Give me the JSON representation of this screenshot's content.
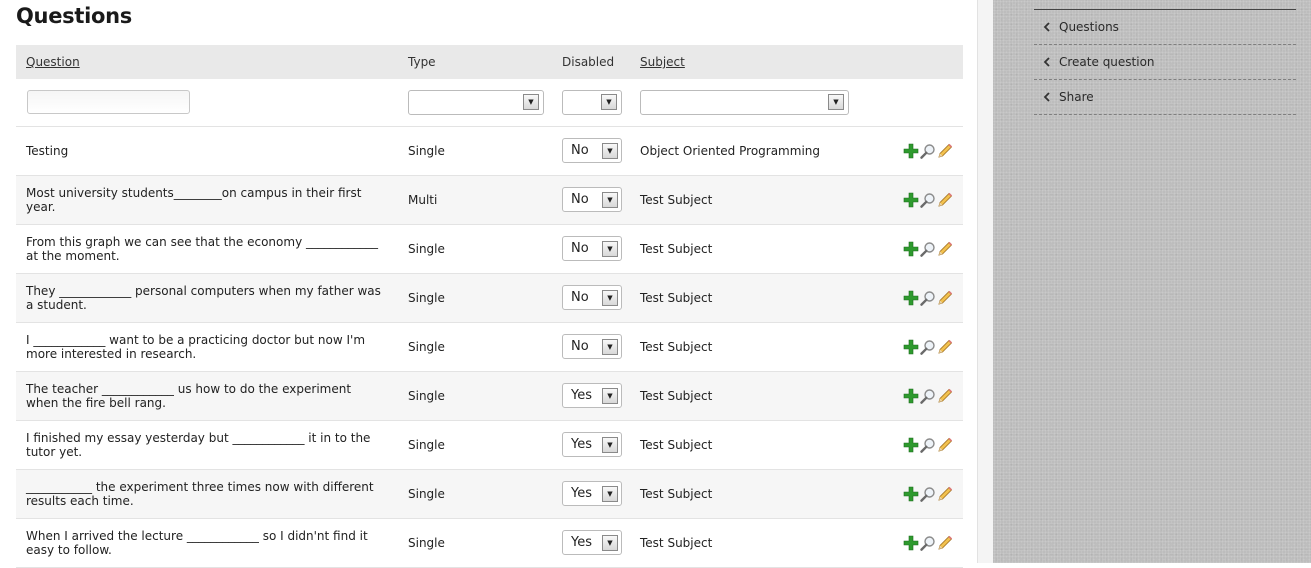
{
  "page": {
    "title": "Questions"
  },
  "table": {
    "headers": {
      "question": "Question",
      "type": "Type",
      "disabled": "Disabled",
      "subject": "Subject"
    },
    "filters": {
      "question_value": "",
      "type_value": "",
      "disabled_value": "",
      "subject_value": ""
    },
    "rows": [
      {
        "question": "Testing",
        "type": "Single",
        "disabled": "No",
        "subject": "Object Oriented Programming"
      },
      {
        "question": "Most university students________on campus in their first year.",
        "type": "Multi",
        "disabled": "No",
        "subject": "Test Subject"
      },
      {
        "question": "From this graph we can see that the economy ____________ at the moment.",
        "type": "Single",
        "disabled": "No",
        "subject": "Test Subject"
      },
      {
        "question": "They ____________ personal computers when my father was a student.",
        "type": "Single",
        "disabled": "No",
        "subject": "Test Subject"
      },
      {
        "question": "I ____________ want to be a practicing doctor but now I'm more interested in research.",
        "type": "Single",
        "disabled": "No",
        "subject": "Test Subject"
      },
      {
        "question": "The teacher ____________ us how to do the experiment when the fire bell rang.",
        "type": "Single",
        "disabled": "Yes",
        "subject": "Test Subject"
      },
      {
        "question": "I finished my essay yesterday but ____________ it in to the tutor yet.",
        "type": "Single",
        "disabled": "Yes",
        "subject": "Test Subject"
      },
      {
        "question": "___________ the experiment three times now with different results each time.",
        "type": "Single",
        "disabled": "Yes",
        "subject": "Test Subject"
      },
      {
        "question": "When I arrived the lecture ____________ so I didn'nt find it easy to follow.",
        "type": "Single",
        "disabled": "Yes",
        "subject": "Test Subject"
      }
    ]
  },
  "sidebar": {
    "items": [
      {
        "label": "Questions"
      },
      {
        "label": "Create question"
      },
      {
        "label": "Share"
      }
    ]
  },
  "icons": {
    "add": "plus-icon",
    "view": "magnifier-icon",
    "edit": "pencil-icon",
    "nav": "chevron-left-icon"
  },
  "colors": {
    "sidebar_bg": "#bdbdbd",
    "header_bg": "#e9e9e9",
    "add_green": "#2e9a2e"
  }
}
